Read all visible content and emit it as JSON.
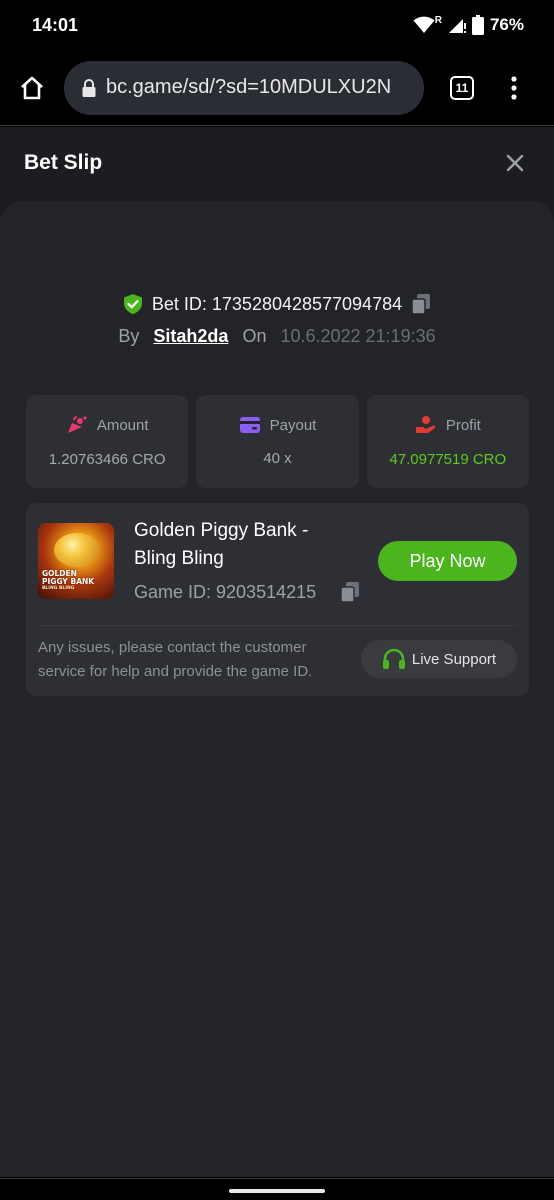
{
  "status_bar": {
    "time": "14:01",
    "battery": "76%",
    "icons": [
      "wifi-icon",
      "signal-icon",
      "battery-icon"
    ],
    "roaming": "R"
  },
  "browser": {
    "url": "bc.game/sd/?sd=10MDULXU2N",
    "tab_count": "11",
    "icons": [
      "home-icon",
      "lock-icon",
      "tabs-icon",
      "more-vert-icon"
    ]
  },
  "modal": {
    "title": "Bet Slip",
    "close_icon": "close-icon"
  },
  "bet": {
    "id_label": "Bet ID: 1735280428577094784",
    "by_label": "By",
    "username": "Sitah2da",
    "on_label": "On",
    "date": "10.6.2022 21:19:36"
  },
  "stats": {
    "amount": {
      "label": "Amount",
      "value": "1.20763466 CRO",
      "icon": "amount-icon",
      "icon_color": "#e8386d"
    },
    "payout": {
      "label": "Payout",
      "value": "40 x",
      "icon": "wallet-icon",
      "icon_color": "#8b5cf6"
    },
    "profit": {
      "label": "Profit",
      "value": "47.0977519 CRO",
      "icon": "profit-hand-icon",
      "icon_color": "#e23b2e"
    }
  },
  "game": {
    "title": "Golden Piggy Bank - Bling Bling",
    "thumb_line1": "GOLDEN",
    "thumb_line2": "PIGGY BANK",
    "thumb_line3": "BLING BLING",
    "game_id_label": "Game ID: 9203514215",
    "play_label": "Play Now",
    "support_note": "Any issues, please contact the customer service for help and provide the game ID.",
    "support_label": "Live Support"
  },
  "colors": {
    "accent_green": "#4ab51c",
    "profit_green": "#5ecb1b",
    "panel_bg": "#232428",
    "card_bg": "#2d2f34"
  }
}
